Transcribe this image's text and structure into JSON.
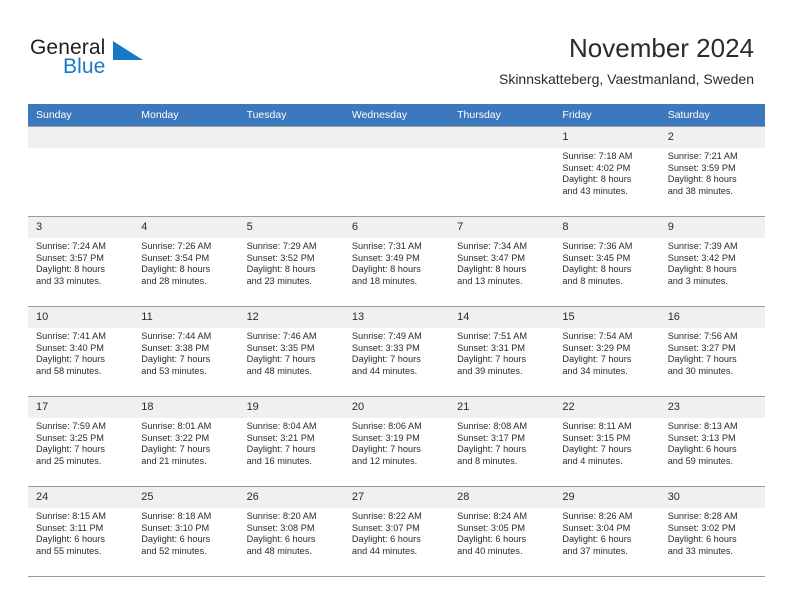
{
  "brand": {
    "name_part1": "General",
    "name_part2": "Blue",
    "mark_icon": "triangle-logo-icon",
    "accent_color": "#1878c8"
  },
  "header": {
    "title": "November 2024",
    "subtitle": "Skinnskatteberg, Vaestmanland, Sweden"
  },
  "theme": {
    "header_blue": "#3b78bd",
    "daynum_gray": "#f0f0f0",
    "grid_line": "#9a9a9a"
  },
  "calendar": {
    "weekday_headers": [
      "Sunday",
      "Monday",
      "Tuesday",
      "Wednesday",
      "Thursday",
      "Friday",
      "Saturday"
    ],
    "weeks": [
      [
        {
          "day": "",
          "empty": true,
          "lines": []
        },
        {
          "day": "",
          "empty": true,
          "lines": []
        },
        {
          "day": "",
          "empty": true,
          "lines": []
        },
        {
          "day": "",
          "empty": true,
          "lines": []
        },
        {
          "day": "",
          "empty": true,
          "lines": []
        },
        {
          "day": "1",
          "empty": false,
          "lines": [
            "Sunrise: 7:18 AM",
            "Sunset: 4:02 PM",
            "Daylight: 8 hours",
            "and 43 minutes."
          ]
        },
        {
          "day": "2",
          "empty": false,
          "lines": [
            "Sunrise: 7:21 AM",
            "Sunset: 3:59 PM",
            "Daylight: 8 hours",
            "and 38 minutes."
          ]
        }
      ],
      [
        {
          "day": "3",
          "empty": false,
          "lines": [
            "Sunrise: 7:24 AM",
            "Sunset: 3:57 PM",
            "Daylight: 8 hours",
            "and 33 minutes."
          ]
        },
        {
          "day": "4",
          "empty": false,
          "lines": [
            "Sunrise: 7:26 AM",
            "Sunset: 3:54 PM",
            "Daylight: 8 hours",
            "and 28 minutes."
          ]
        },
        {
          "day": "5",
          "empty": false,
          "lines": [
            "Sunrise: 7:29 AM",
            "Sunset: 3:52 PM",
            "Daylight: 8 hours",
            "and 23 minutes."
          ]
        },
        {
          "day": "6",
          "empty": false,
          "lines": [
            "Sunrise: 7:31 AM",
            "Sunset: 3:49 PM",
            "Daylight: 8 hours",
            "and 18 minutes."
          ]
        },
        {
          "day": "7",
          "empty": false,
          "lines": [
            "Sunrise: 7:34 AM",
            "Sunset: 3:47 PM",
            "Daylight: 8 hours",
            "and 13 minutes."
          ]
        },
        {
          "day": "8",
          "empty": false,
          "lines": [
            "Sunrise: 7:36 AM",
            "Sunset: 3:45 PM",
            "Daylight: 8 hours",
            "and 8 minutes."
          ]
        },
        {
          "day": "9",
          "empty": false,
          "lines": [
            "Sunrise: 7:39 AM",
            "Sunset: 3:42 PM",
            "Daylight: 8 hours",
            "and 3 minutes."
          ]
        }
      ],
      [
        {
          "day": "10",
          "empty": false,
          "lines": [
            "Sunrise: 7:41 AM",
            "Sunset: 3:40 PM",
            "Daylight: 7 hours",
            "and 58 minutes."
          ]
        },
        {
          "day": "11",
          "empty": false,
          "lines": [
            "Sunrise: 7:44 AM",
            "Sunset: 3:38 PM",
            "Daylight: 7 hours",
            "and 53 minutes."
          ]
        },
        {
          "day": "12",
          "empty": false,
          "lines": [
            "Sunrise: 7:46 AM",
            "Sunset: 3:35 PM",
            "Daylight: 7 hours",
            "and 48 minutes."
          ]
        },
        {
          "day": "13",
          "empty": false,
          "lines": [
            "Sunrise: 7:49 AM",
            "Sunset: 3:33 PM",
            "Daylight: 7 hours",
            "and 44 minutes."
          ]
        },
        {
          "day": "14",
          "empty": false,
          "lines": [
            "Sunrise: 7:51 AM",
            "Sunset: 3:31 PM",
            "Daylight: 7 hours",
            "and 39 minutes."
          ]
        },
        {
          "day": "15",
          "empty": false,
          "lines": [
            "Sunrise: 7:54 AM",
            "Sunset: 3:29 PM",
            "Daylight: 7 hours",
            "and 34 minutes."
          ]
        },
        {
          "day": "16",
          "empty": false,
          "lines": [
            "Sunrise: 7:56 AM",
            "Sunset: 3:27 PM",
            "Daylight: 7 hours",
            "and 30 minutes."
          ]
        }
      ],
      [
        {
          "day": "17",
          "empty": false,
          "lines": [
            "Sunrise: 7:59 AM",
            "Sunset: 3:25 PM",
            "Daylight: 7 hours",
            "and 25 minutes."
          ]
        },
        {
          "day": "18",
          "empty": false,
          "lines": [
            "Sunrise: 8:01 AM",
            "Sunset: 3:22 PM",
            "Daylight: 7 hours",
            "and 21 minutes."
          ]
        },
        {
          "day": "19",
          "empty": false,
          "lines": [
            "Sunrise: 8:04 AM",
            "Sunset: 3:21 PM",
            "Daylight: 7 hours",
            "and 16 minutes."
          ]
        },
        {
          "day": "20",
          "empty": false,
          "lines": [
            "Sunrise: 8:06 AM",
            "Sunset: 3:19 PM",
            "Daylight: 7 hours",
            "and 12 minutes."
          ]
        },
        {
          "day": "21",
          "empty": false,
          "lines": [
            "Sunrise: 8:08 AM",
            "Sunset: 3:17 PM",
            "Daylight: 7 hours",
            "and 8 minutes."
          ]
        },
        {
          "day": "22",
          "empty": false,
          "lines": [
            "Sunrise: 8:11 AM",
            "Sunset: 3:15 PM",
            "Daylight: 7 hours",
            "and 4 minutes."
          ]
        },
        {
          "day": "23",
          "empty": false,
          "lines": [
            "Sunrise: 8:13 AM",
            "Sunset: 3:13 PM",
            "Daylight: 6 hours",
            "and 59 minutes."
          ]
        }
      ],
      [
        {
          "day": "24",
          "empty": false,
          "lines": [
            "Sunrise: 8:15 AM",
            "Sunset: 3:11 PM",
            "Daylight: 6 hours",
            "and 55 minutes."
          ]
        },
        {
          "day": "25",
          "empty": false,
          "lines": [
            "Sunrise: 8:18 AM",
            "Sunset: 3:10 PM",
            "Daylight: 6 hours",
            "and 52 minutes."
          ]
        },
        {
          "day": "26",
          "empty": false,
          "lines": [
            "Sunrise: 8:20 AM",
            "Sunset: 3:08 PM",
            "Daylight: 6 hours",
            "and 48 minutes."
          ]
        },
        {
          "day": "27",
          "empty": false,
          "lines": [
            "Sunrise: 8:22 AM",
            "Sunset: 3:07 PM",
            "Daylight: 6 hours",
            "and 44 minutes."
          ]
        },
        {
          "day": "28",
          "empty": false,
          "lines": [
            "Sunrise: 8:24 AM",
            "Sunset: 3:05 PM",
            "Daylight: 6 hours",
            "and 40 minutes."
          ]
        },
        {
          "day": "29",
          "empty": false,
          "lines": [
            "Sunrise: 8:26 AM",
            "Sunset: 3:04 PM",
            "Daylight: 6 hours",
            "and 37 minutes."
          ]
        },
        {
          "day": "30",
          "empty": false,
          "lines": [
            "Sunrise: 8:28 AM",
            "Sunset: 3:02 PM",
            "Daylight: 6 hours",
            "and 33 minutes."
          ]
        }
      ]
    ]
  }
}
